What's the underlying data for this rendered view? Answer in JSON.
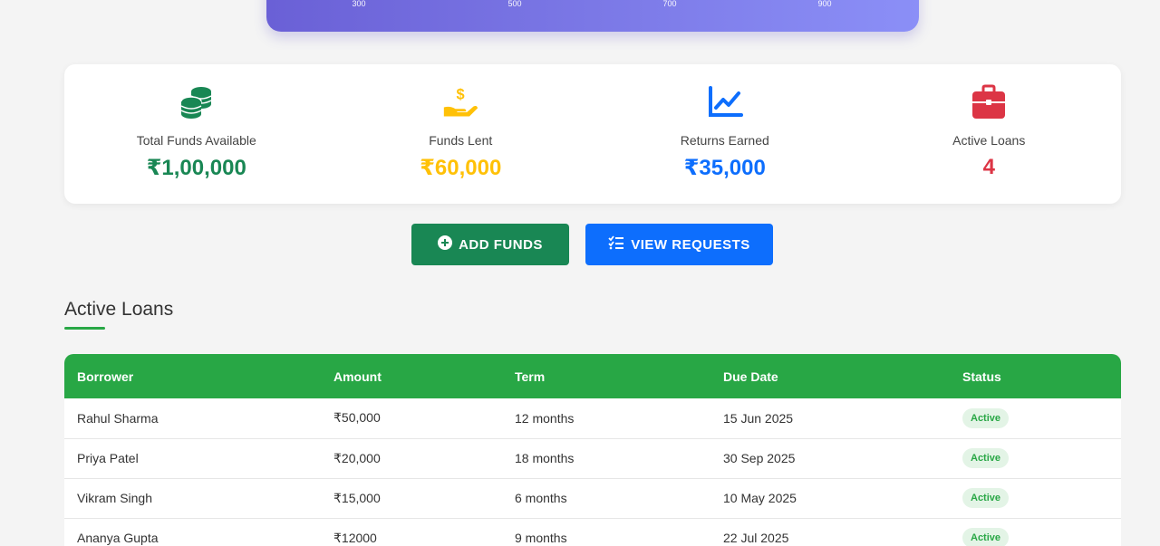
{
  "hero": {
    "ticks": [
      "300",
      "500",
      "700",
      "900"
    ]
  },
  "stats": [
    {
      "icon": "coins-icon",
      "label": "Total Funds Available",
      "value": "₹1,00,000",
      "color": "#198754"
    },
    {
      "icon": "hand-holding-dollar-icon",
      "label": "Funds Lent",
      "value": "₹60,000",
      "color": "#ffc107"
    },
    {
      "icon": "chart-line-icon",
      "label": "Returns Earned",
      "value": "₹35,000",
      "color": "#0d6efd"
    },
    {
      "icon": "briefcase-icon",
      "label": "Active Loans",
      "value": "4",
      "color": "#dc3545"
    }
  ],
  "actions": {
    "add_funds": "ADD FUNDS",
    "view_requests": "VIEW REQUESTS"
  },
  "active_loans": {
    "title": "Active Loans",
    "columns": [
      "Borrower",
      "Amount",
      "Term",
      "Due Date",
      "Status"
    ],
    "rows": [
      {
        "borrower": "Rahul Sharma",
        "amount": "₹50,000",
        "term": "12 months",
        "due": "15 Jun 2025",
        "status": "Active"
      },
      {
        "borrower": "Priya Patel",
        "amount": "₹20,000",
        "term": "18 months",
        "due": "30 Sep 2025",
        "status": "Active"
      },
      {
        "borrower": "Vikram Singh",
        "amount": "₹15,000",
        "term": "6 months",
        "due": "10 May 2025",
        "status": "Active"
      },
      {
        "borrower": "Ananya Gupta",
        "amount": "₹12000",
        "term": "9 months",
        "due": "22 Jul 2025",
        "status": "Active"
      }
    ]
  }
}
